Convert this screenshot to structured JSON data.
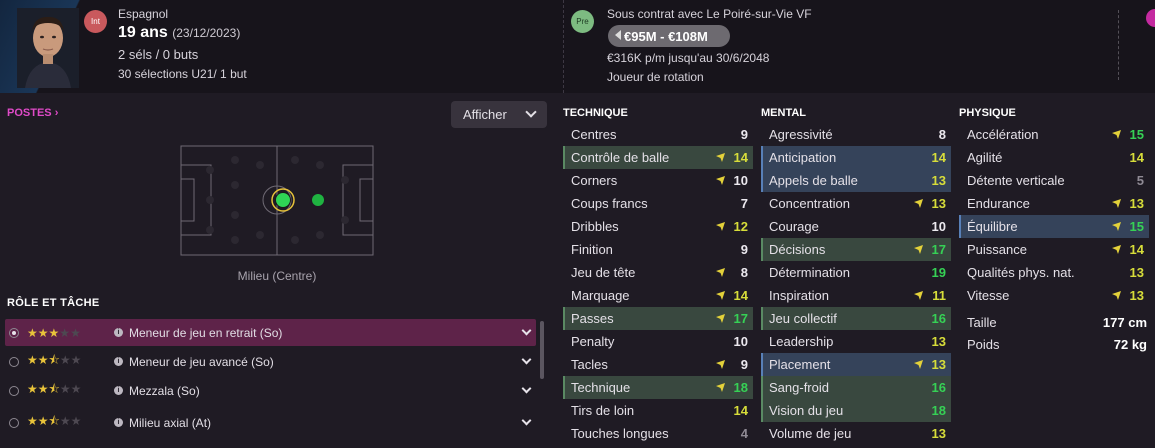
{
  "header": {
    "nationality_badge": "Int",
    "nationality": "Espagnol",
    "age": "19 ans",
    "birthdate": "(23/12/2023)",
    "caps": "2 séls / 0 buts",
    "u21_caps": "30 sélections U21/ 1 but",
    "contract_badge": "Pre",
    "contract": "Sous contrat avec Le Poiré-sur-Vie VF",
    "value": "€95M - €108M",
    "wage": "€316K p/m jusqu'au 30/6/2048",
    "role_status": "Joueur de rotation"
  },
  "positions": {
    "title": "POSTES",
    "show_button": "Afficher",
    "pitch_label": "Milieu (Centre)"
  },
  "roles": {
    "title": "RÔLE ET TÂCHE",
    "items": [
      {
        "name": "Meneur de jeu en retrait (So)",
        "stars": 3,
        "half": false,
        "selected": true
      },
      {
        "name": "Meneur de jeu avancé (So)",
        "stars": 2,
        "half": true,
        "selected": false
      },
      {
        "name": "Mezzala (So)",
        "stars": 2,
        "half": true,
        "selected": false
      },
      {
        "name": "Milieu axial (At)",
        "stars": 2,
        "half": true,
        "selected": false
      }
    ]
  },
  "technique": {
    "title": "TECHNIQUE",
    "items": [
      {
        "name": "Centres",
        "value": "9",
        "style": "plain",
        "arrow": false
      },
      {
        "name": "Contrôle de balle",
        "value": "14",
        "style": "green",
        "arrow": true
      },
      {
        "name": "Corners",
        "value": "10",
        "style": "plain",
        "arrow": true
      },
      {
        "name": "Coups francs",
        "value": "7",
        "style": "plain",
        "arrow": false
      },
      {
        "name": "Dribbles",
        "value": "12",
        "style": "plain",
        "arrow": true
      },
      {
        "name": "Finition",
        "value": "9",
        "style": "plain",
        "arrow": false
      },
      {
        "name": "Jeu de tête",
        "value": "8",
        "style": "plain",
        "arrow": true
      },
      {
        "name": "Marquage",
        "value": "14",
        "style": "plain",
        "arrow": true
      },
      {
        "name": "Passes",
        "value": "17",
        "style": "green",
        "arrow": true
      },
      {
        "name": "Penalty",
        "value": "10",
        "style": "plain",
        "arrow": false
      },
      {
        "name": "Tacles",
        "value": "9",
        "style": "plain",
        "arrow": true
      },
      {
        "name": "Technique",
        "value": "18",
        "style": "green",
        "arrow": true
      },
      {
        "name": "Tirs de loin",
        "value": "14",
        "style": "plain",
        "arrow": false
      },
      {
        "name": "Touches longues",
        "value": "4",
        "style": "plain",
        "arrow": false
      }
    ]
  },
  "mental": {
    "title": "MENTAL",
    "items": [
      {
        "name": "Agressivité",
        "value": "8",
        "style": "plain",
        "arrow": false
      },
      {
        "name": "Anticipation",
        "value": "14",
        "style": "blue",
        "arrow": false
      },
      {
        "name": "Appels de balle",
        "value": "13",
        "style": "blue",
        "arrow": false
      },
      {
        "name": "Concentration",
        "value": "13",
        "style": "plain",
        "arrow": true
      },
      {
        "name": "Courage",
        "value": "10",
        "style": "plain",
        "arrow": false
      },
      {
        "name": "Décisions",
        "value": "17",
        "style": "green",
        "arrow": true
      },
      {
        "name": "Détermination",
        "value": "19",
        "style": "plain",
        "arrow": false
      },
      {
        "name": "Inspiration",
        "value": "11",
        "style": "plain",
        "arrow": true
      },
      {
        "name": "Jeu collectif",
        "value": "16",
        "style": "green",
        "arrow": false
      },
      {
        "name": "Leadership",
        "value": "13",
        "style": "plain",
        "arrow": false
      },
      {
        "name": "Placement",
        "value": "13",
        "style": "blue",
        "arrow": true
      },
      {
        "name": "Sang-froid",
        "value": "16",
        "style": "green",
        "arrow": false
      },
      {
        "name": "Vision du jeu",
        "value": "18",
        "style": "green",
        "arrow": false
      },
      {
        "name": "Volume de jeu",
        "value": "13",
        "style": "plain",
        "arrow": false
      }
    ]
  },
  "physique": {
    "title": "PHYSIQUE",
    "items": [
      {
        "name": "Accélération",
        "value": "15",
        "style": "plain",
        "arrow": true
      },
      {
        "name": "Agilité",
        "value": "14",
        "style": "plain",
        "arrow": false
      },
      {
        "name": "Détente verticale",
        "value": "5",
        "style": "plain",
        "arrow": false
      },
      {
        "name": "Endurance",
        "value": "13",
        "style": "plain",
        "arrow": true
      },
      {
        "name": "Équilibre",
        "value": "15",
        "style": "blue",
        "arrow": true
      },
      {
        "name": "Puissance",
        "value": "14",
        "style": "plain",
        "arrow": true
      },
      {
        "name": "Qualités phys. nat.",
        "value": "13",
        "style": "plain",
        "arrow": false
      },
      {
        "name": "Vitesse",
        "value": "13",
        "style": "plain",
        "arrow": true
      }
    ],
    "height_label": "Taille",
    "height_value": "177 cm",
    "weight_label": "Poids",
    "weight_value": "72 kg"
  }
}
